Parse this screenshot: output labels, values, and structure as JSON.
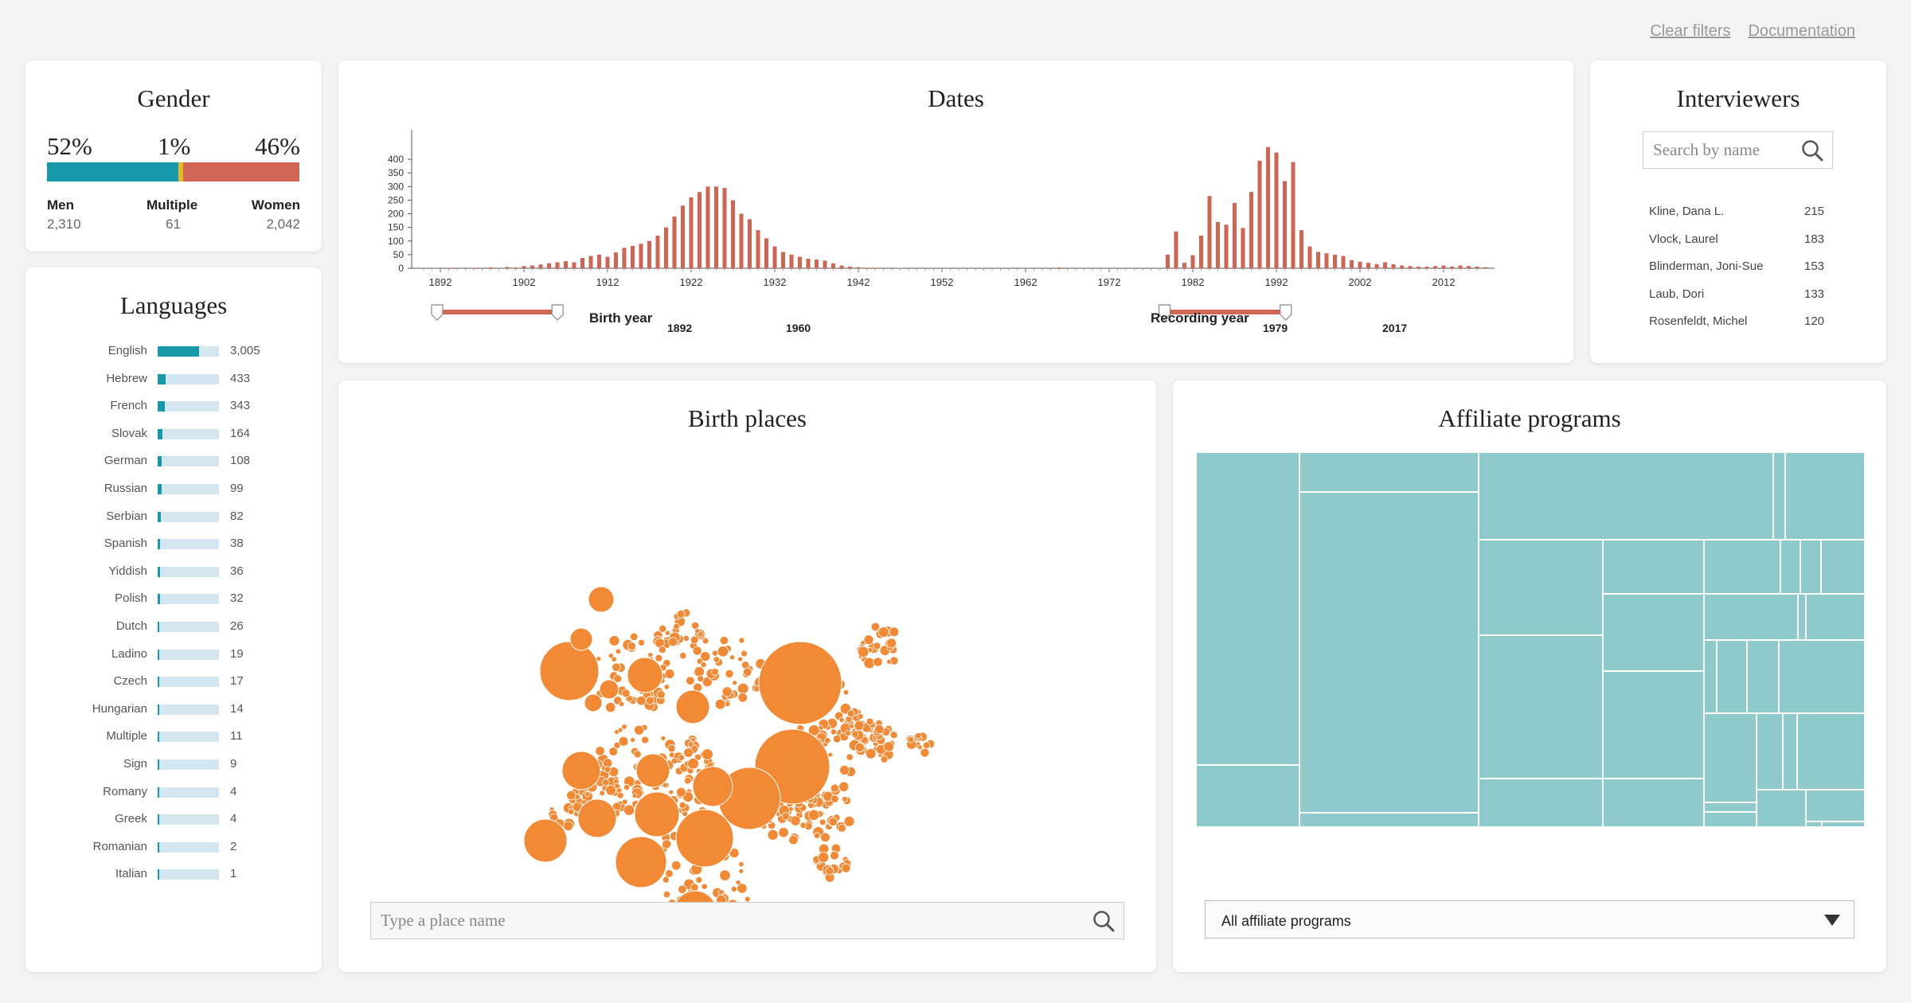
{
  "top_links": {
    "clear": "Clear filters",
    "docs": "Documentation"
  },
  "gender": {
    "title": "Gender",
    "men": {
      "pct": "52%",
      "label": "Men",
      "count": "2,310",
      "share": 0.52
    },
    "multiple": {
      "pct": "1%",
      "label": "Multiple",
      "count": "61",
      "share": 0.014
    },
    "women": {
      "pct": "46%",
      "label": "Women",
      "count": "2,042",
      "share": 0.466
    },
    "colors": {
      "men": "#1799aa",
      "multiple": "#e4b72a",
      "women": "#cf6552"
    }
  },
  "languages": {
    "title": "Languages",
    "items": [
      {
        "name": "English",
        "count": "3,005",
        "value": 3005
      },
      {
        "name": "Hebrew",
        "count": "433",
        "value": 433
      },
      {
        "name": "French",
        "count": "343",
        "value": 343
      },
      {
        "name": "Slovak",
        "count": "164",
        "value": 164
      },
      {
        "name": "German",
        "count": "108",
        "value": 108
      },
      {
        "name": "Russian",
        "count": "99",
        "value": 99
      },
      {
        "name": "Serbian",
        "count": "82",
        "value": 82
      },
      {
        "name": "Spanish",
        "count": "38",
        "value": 38
      },
      {
        "name": "Yiddish",
        "count": "36",
        "value": 36
      },
      {
        "name": "Polish",
        "count": "32",
        "value": 32
      },
      {
        "name": "Dutch",
        "count": "26",
        "value": 26
      },
      {
        "name": "Ladino",
        "count": "19",
        "value": 19
      },
      {
        "name": "Czech",
        "count": "17",
        "value": 17
      },
      {
        "name": "Hungarian",
        "count": "14",
        "value": 14
      },
      {
        "name": "Multiple",
        "count": "11",
        "value": 11
      },
      {
        "name": "Sign",
        "count": "9",
        "value": 9
      },
      {
        "name": "Romany",
        "count": "4",
        "value": 4
      },
      {
        "name": "Greek",
        "count": "4",
        "value": 4
      },
      {
        "name": "Romanian",
        "count": "2",
        "value": 2
      },
      {
        "name": "Italian",
        "count": "1",
        "value": 1
      }
    ],
    "max": 5000
  },
  "dates": {
    "title": "Dates",
    "y_ticks": [
      "0",
      "50",
      "100",
      "150",
      "200",
      "250",
      "300",
      "350",
      "400"
    ],
    "x_ticks": [
      "1892",
      "1902",
      "1912",
      "1922",
      "1932",
      "1942",
      "1952",
      "1962",
      "1972",
      "1982",
      "1992",
      "2002",
      "2012"
    ],
    "birth_slider": {
      "label": "Birth year",
      "min": "1892",
      "max": "1960"
    },
    "recording_slider": {
      "label": "Recording year",
      "min": "1979",
      "max": "2017"
    },
    "bar_color": "#cf6552"
  },
  "chart_data": {
    "type": "bar",
    "title": "Dates",
    "xlabel": "",
    "ylabel": "",
    "ylim": [
      0,
      450
    ],
    "xlim": [
      1890,
      2020
    ],
    "series": [
      {
        "years": [
          1893,
          1896,
          1898,
          1900,
          1901,
          1902,
          1903,
          1904,
          1905,
          1906,
          1907,
          1908,
          1909,
          1910,
          1911,
          1912,
          1913,
          1914,
          1915,
          1916,
          1917,
          1918,
          1919,
          1920,
          1921,
          1922,
          1923,
          1924,
          1925,
          1926,
          1927,
          1928,
          1929,
          1930,
          1931,
          1932,
          1933,
          1934,
          1935,
          1936,
          1937,
          1938,
          1939,
          1940,
          1941,
          1942,
          1943,
          1944,
          1947,
          1957,
          1966
        ],
        "values": [
          2,
          2,
          3,
          5,
          3,
          8,
          10,
          14,
          18,
          22,
          26,
          22,
          38,
          45,
          50,
          42,
          58,
          75,
          82,
          90,
          100,
          120,
          150,
          190,
          230,
          260,
          280,
          300,
          300,
          295,
          250,
          200,
          180,
          140,
          110,
          80,
          60,
          50,
          42,
          35,
          32,
          28,
          18,
          10,
          6,
          4,
          2,
          2,
          1,
          1,
          3
        ]
      },
      {
        "years": [
          1979,
          1980,
          1981,
          1982,
          1983,
          1984,
          1985,
          1986,
          1987,
          1988,
          1989,
          1990,
          1991,
          1992,
          1993,
          1994,
          1995,
          1996,
          1997,
          1998,
          1999,
          2000,
          2001,
          2002,
          2003,
          2004,
          2005,
          2006,
          2007,
          2008,
          2009,
          2010,
          2011,
          2012,
          2013,
          2014,
          2015,
          2016,
          2017
        ],
        "values": [
          50,
          135,
          20,
          48,
          120,
          265,
          170,
          160,
          240,
          148,
          280,
          395,
          445,
          425,
          320,
          390,
          140,
          80,
          60,
          55,
          50,
          45,
          30,
          24,
          20,
          15,
          22,
          15,
          10,
          8,
          6,
          6,
          8,
          10,
          6,
          10,
          8,
          6,
          4
        ]
      }
    ]
  },
  "interviewers": {
    "title": "Interviewers",
    "search_placeholder": "Search by name",
    "items": [
      {
        "name": "Kline, Dana L.",
        "count": "215"
      },
      {
        "name": "Vlock, Laurel",
        "count": "183"
      },
      {
        "name": "Blinderman, Joni-Sue",
        "count": "153"
      },
      {
        "name": "Laub, Dori",
        "count": "133"
      },
      {
        "name": "Rosenfeldt, Michel",
        "count": "120"
      }
    ]
  },
  "birth_places": {
    "title": "Birth places",
    "search_placeholder": "Type a place name",
    "bubble_color": "#f28a35"
  },
  "affiliate": {
    "title": "Affiliate programs",
    "select_value": "All affiliate programs",
    "tile_color": "#8ec9cc"
  }
}
